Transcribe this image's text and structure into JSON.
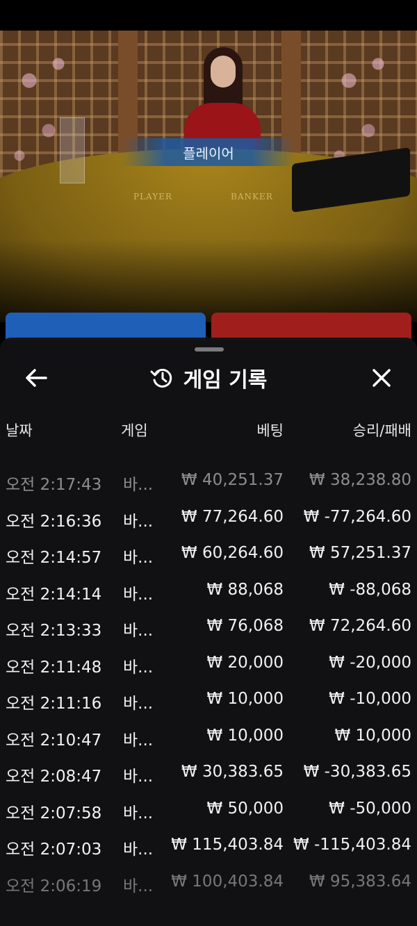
{
  "video": {
    "result_banner": "플레이어",
    "table_labels": {
      "player": "PLAYER",
      "banker": "BANKER"
    }
  },
  "history": {
    "title": "게임 기록",
    "columns": {
      "date": "날짜",
      "game": "게임",
      "bet": "베팅",
      "result": "승리/패배"
    },
    "rows": [
      {
        "time": "오전 2:17:43",
        "game": "바...",
        "bet": "₩ 40,251.37",
        "result": "₩ 38,238.80"
      },
      {
        "time": "오전 2:16:36",
        "game": "바...",
        "bet": "₩ 77,264.60",
        "result": "₩ -77,264.60"
      },
      {
        "time": "오전 2:14:57",
        "game": "바...",
        "bet": "₩ 60,264.60",
        "result": "₩ 57,251.37"
      },
      {
        "time": "오전 2:14:14",
        "game": "바...",
        "bet": "₩ 88,068",
        "result": "₩ -88,068"
      },
      {
        "time": "오전 2:13:33",
        "game": "바...",
        "bet": "₩ 76,068",
        "result": "₩ 72,264.60"
      },
      {
        "time": "오전 2:11:48",
        "game": "바...",
        "bet": "₩ 20,000",
        "result": "₩ -20,000"
      },
      {
        "time": "오전 2:11:16",
        "game": "바...",
        "bet": "₩ 10,000",
        "result": "₩ -10,000"
      },
      {
        "time": "오전 2:10:47",
        "game": "바...",
        "bet": "₩ 10,000",
        "result": "₩ 10,000"
      },
      {
        "time": "오전 2:08:47",
        "game": "바...",
        "bet": "₩ 30,383.65",
        "result": "₩ -30,383.65"
      },
      {
        "time": "오전 2:07:58",
        "game": "바...",
        "bet": "₩ 50,000",
        "result": "₩ -50,000"
      },
      {
        "time": "오전 2:07:03",
        "game": "바...",
        "bet": "₩ 115,403.84",
        "result": "₩ -115,403.84"
      },
      {
        "time": "오전 2:06:19",
        "game": "바...",
        "bet": "₩ 100,403.84",
        "result": "₩ 95,383.64"
      }
    ]
  },
  "icons": {
    "back": "arrow-left-icon",
    "history": "history-clock-icon",
    "close": "close-icon"
  },
  "colors": {
    "player": "#1f5fb8",
    "banker": "#a01f1c",
    "sheet": "#121214"
  }
}
